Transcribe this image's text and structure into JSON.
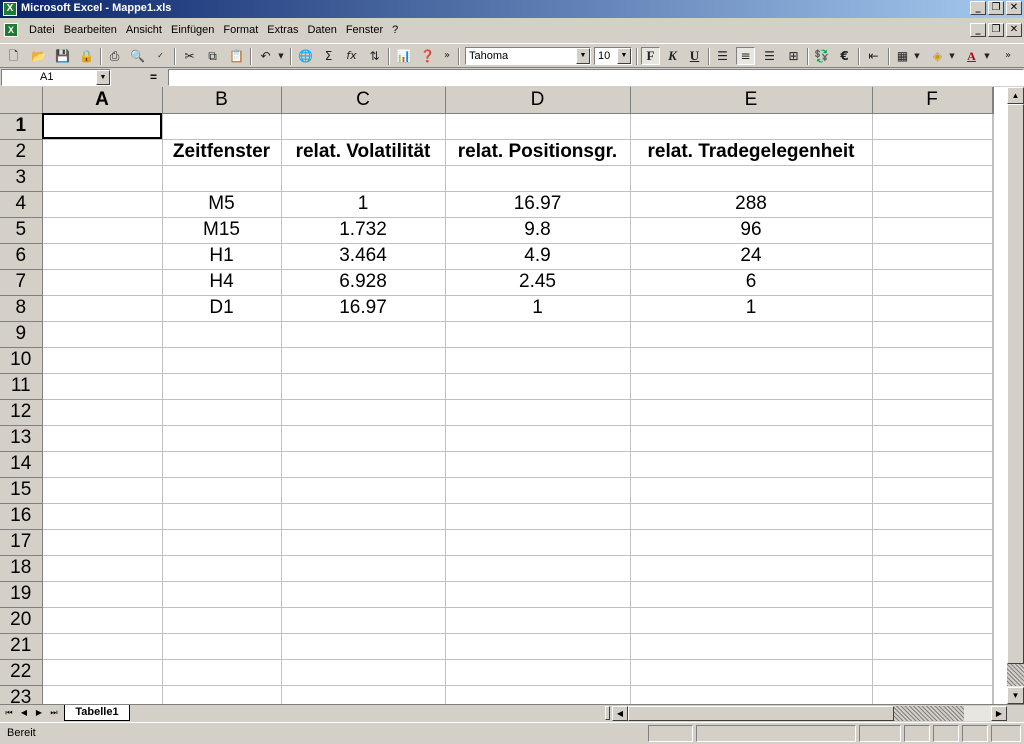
{
  "window": {
    "title": "Microsoft Excel - Mappe1.xls",
    "app_icon_letter": "X"
  },
  "menu": {
    "items": [
      "Datei",
      "Bearbeiten",
      "Ansicht",
      "Einfügen",
      "Format",
      "Extras",
      "Daten",
      "Fenster",
      "?"
    ]
  },
  "toolbar": {
    "font_name": "Tahoma",
    "font_size": "10",
    "bold_label": "F",
    "italic_label": "K",
    "underline_label": "U",
    "icons": [
      "new-icon",
      "open-icon",
      "save-icon",
      "permission-icon",
      "print-icon",
      "print-preview-icon",
      "spelling-icon",
      "cut-icon",
      "copy-icon",
      "paste-icon",
      "undo-icon",
      "hyperlink-icon",
      "autosum-icon",
      "function-icon",
      "sort-ascending-icon",
      "chart-wizard-icon",
      "help-icon",
      "align-left-icon",
      "align-center-icon",
      "align-right-icon",
      "merge-center-icon",
      "currency-icon",
      "euro-icon",
      "decrease-indent-icon",
      "borders-icon",
      "fill-color-icon",
      "font-color-icon"
    ]
  },
  "formula_bar": {
    "name_box": "A1",
    "equals": "=",
    "formula": ""
  },
  "grid": {
    "columns": [
      "A",
      "B",
      "C",
      "D",
      "E",
      "F"
    ],
    "rows": [
      {
        "num": "1",
        "cells": [
          "",
          "",
          "",
          "",
          "",
          ""
        ]
      },
      {
        "num": "2",
        "cells": [
          "",
          "Zeitfenster",
          "relat. Volatilität",
          "relat. Positionsgr.",
          "relat. Tradegelegenheit",
          ""
        ]
      },
      {
        "num": "3",
        "cells": [
          "",
          "",
          "",
          "",
          "",
          ""
        ]
      },
      {
        "num": "4",
        "cells": [
          "",
          "M5",
          "1",
          "16.97",
          "288",
          ""
        ]
      },
      {
        "num": "5",
        "cells": [
          "",
          "M15",
          "1.732",
          "9.8",
          "96",
          ""
        ]
      },
      {
        "num": "6",
        "cells": [
          "",
          "H1",
          "3.464",
          "4.9",
          "24",
          ""
        ]
      },
      {
        "num": "7",
        "cells": [
          "",
          "H4",
          "6.928",
          "2.45",
          "6",
          ""
        ]
      },
      {
        "num": "8",
        "cells": [
          "",
          "D1",
          "16.97",
          "1",
          "1",
          ""
        ]
      },
      {
        "num": "9",
        "cells": [
          "",
          "",
          "",
          "",
          "",
          ""
        ]
      },
      {
        "num": "10",
        "cells": [
          "",
          "",
          "",
          "",
          "",
          ""
        ]
      },
      {
        "num": "11",
        "cells": [
          "",
          "",
          "",
          "",
          "",
          ""
        ]
      },
      {
        "num": "12",
        "cells": [
          "",
          "",
          "",
          "",
          "",
          ""
        ]
      },
      {
        "num": "13",
        "cells": [
          "",
          "",
          "",
          "",
          "",
          ""
        ]
      },
      {
        "num": "14",
        "cells": [
          "",
          "",
          "",
          "",
          "",
          ""
        ]
      },
      {
        "num": "15",
        "cells": [
          "",
          "",
          "",
          "",
          "",
          ""
        ]
      },
      {
        "num": "16",
        "cells": [
          "",
          "",
          "",
          "",
          "",
          ""
        ]
      },
      {
        "num": "17",
        "cells": [
          "",
          "",
          "",
          "",
          "",
          ""
        ]
      },
      {
        "num": "18",
        "cells": [
          "",
          "",
          "",
          "",
          "",
          ""
        ]
      },
      {
        "num": "19",
        "cells": [
          "",
          "",
          "",
          "",
          "",
          ""
        ]
      },
      {
        "num": "20",
        "cells": [
          "",
          "",
          "",
          "",
          "",
          ""
        ]
      },
      {
        "num": "21",
        "cells": [
          "",
          "",
          "",
          "",
          "",
          ""
        ]
      },
      {
        "num": "22",
        "cells": [
          "",
          "",
          "",
          "",
          "",
          ""
        ]
      },
      {
        "num": "23",
        "cells": [
          "",
          "",
          "",
          "",
          "",
          ""
        ]
      }
    ]
  },
  "sheets": {
    "active": "Tabelle1"
  },
  "status": {
    "text": "Bereit"
  }
}
